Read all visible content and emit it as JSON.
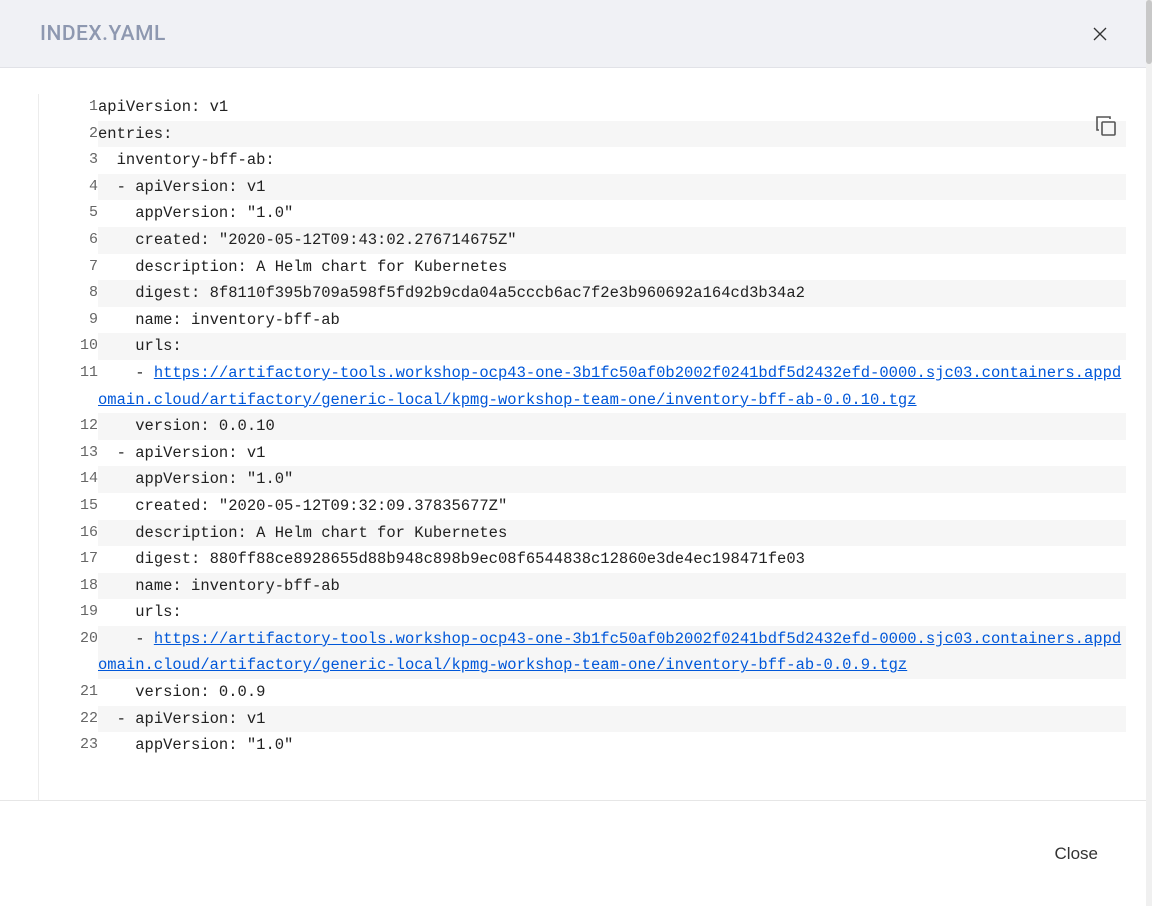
{
  "header": {
    "title": "INDEX.YAML"
  },
  "footer": {
    "close": "Close"
  },
  "code": {
    "lines": [
      {
        "n": 1,
        "indent": 0,
        "text": "apiVersion: v1"
      },
      {
        "n": 2,
        "indent": 0,
        "text": "entries:"
      },
      {
        "n": 3,
        "indent": 1,
        "text": "inventory-bff-ab:"
      },
      {
        "n": 4,
        "indent": 1,
        "text": "- apiVersion: v1"
      },
      {
        "n": 5,
        "indent": 2,
        "text": "appVersion: \"1.0\""
      },
      {
        "n": 6,
        "indent": 2,
        "text": "created: \"2020-05-12T09:43:02.276714675Z\""
      },
      {
        "n": 7,
        "indent": 2,
        "text": "description: A Helm chart for Kubernetes"
      },
      {
        "n": 8,
        "indent": 2,
        "text": "digest: 8f8110f395b709a598f5fd92b9cda04a5cccb6ac7f2e3b960692a164cd3b34a2"
      },
      {
        "n": 9,
        "indent": 2,
        "text": "name: inventory-bff-ab"
      },
      {
        "n": 10,
        "indent": 2,
        "text": "urls:"
      },
      {
        "n": 11,
        "indent": 2,
        "text": "- ",
        "link": "https://artifactory-tools.workshop-ocp43-one-3b1fc50af0b2002f0241bdf5d2432efd-0000.sjc03.containers.appdomain.cloud/artifactory/generic-local/kpmg-workshop-team-one/inventory-bff-ab-0.0.10.tgz"
      },
      {
        "n": 12,
        "indent": 2,
        "text": "version: 0.0.10"
      },
      {
        "n": 13,
        "indent": 1,
        "text": "- apiVersion: v1"
      },
      {
        "n": 14,
        "indent": 2,
        "text": "appVersion: \"1.0\""
      },
      {
        "n": 15,
        "indent": 2,
        "text": "created: \"2020-05-12T09:32:09.37835677Z\""
      },
      {
        "n": 16,
        "indent": 2,
        "text": "description: A Helm chart for Kubernetes"
      },
      {
        "n": 17,
        "indent": 2,
        "text": "digest: 880ff88ce8928655d88b948c898b9ec08f6544838c12860e3de4ec198471fe03"
      },
      {
        "n": 18,
        "indent": 2,
        "text": "name: inventory-bff-ab"
      },
      {
        "n": 19,
        "indent": 2,
        "text": "urls:"
      },
      {
        "n": 20,
        "indent": 2,
        "text": "- ",
        "link": "https://artifactory-tools.workshop-ocp43-one-3b1fc50af0b2002f0241bdf5d2432efd-0000.sjc03.containers.appdomain.cloud/artifactory/generic-local/kpmg-workshop-team-one/inventory-bff-ab-0.0.9.tgz"
      },
      {
        "n": 21,
        "indent": 2,
        "text": "version: 0.0.9"
      },
      {
        "n": 22,
        "indent": 1,
        "text": "- apiVersion: v1"
      },
      {
        "n": 23,
        "indent": 2,
        "text": "appVersion: \"1.0\""
      }
    ]
  }
}
